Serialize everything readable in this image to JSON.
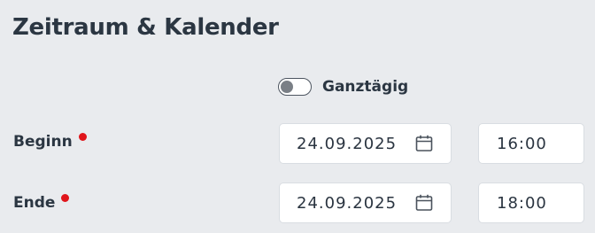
{
  "section": {
    "title": "Zeitraum & Kalender"
  },
  "all_day": {
    "label": "Ganztägig",
    "checked": false
  },
  "start": {
    "label": "Beginn",
    "required": true,
    "date": "24.09.2025",
    "time": "16:00"
  },
  "end": {
    "label": "Ende",
    "required": true,
    "date": "24.09.2025",
    "time": "18:00"
  },
  "icons": {
    "calendar": "calendar-icon"
  },
  "colors": {
    "background": "#e9ebee",
    "text": "#2b3642",
    "required": "#e0151b",
    "field_bg": "#ffffff"
  }
}
